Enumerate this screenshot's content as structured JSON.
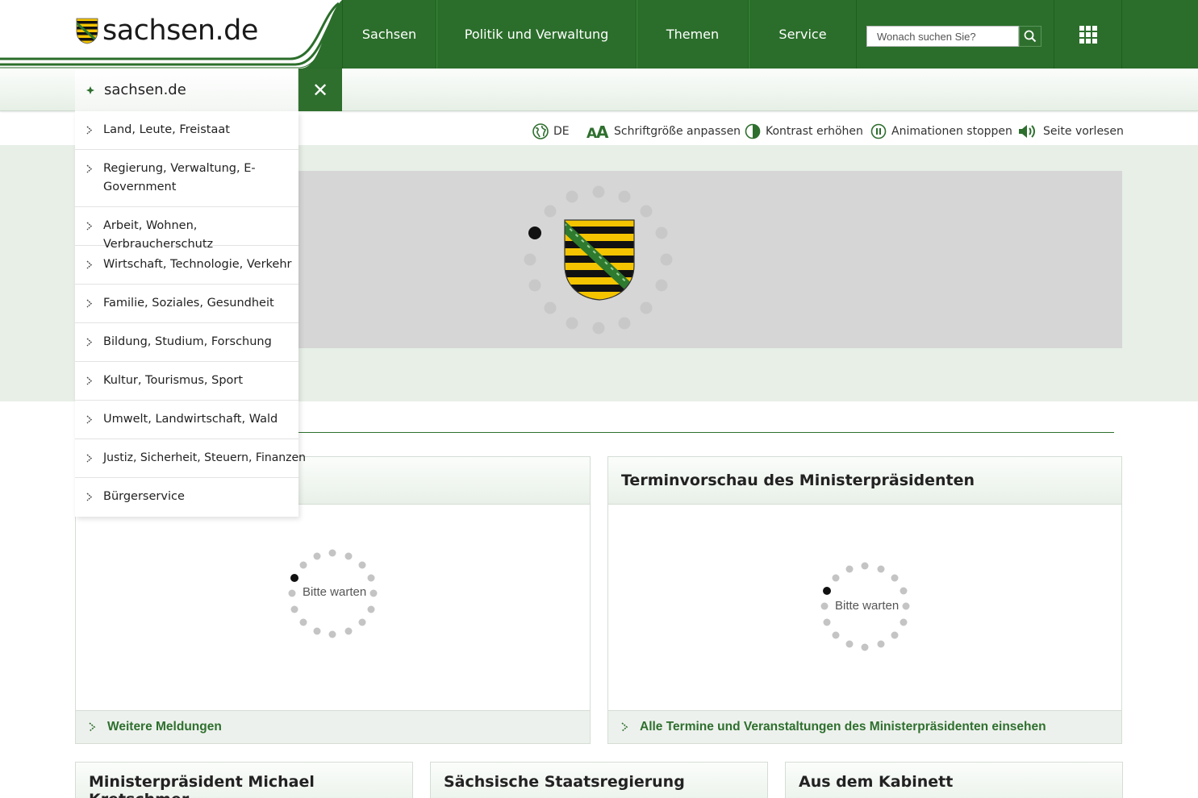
{
  "brand": {
    "site_name": "sachsen.de"
  },
  "nav": {
    "items": [
      {
        "label": "Sachsen"
      },
      {
        "label": "Politik und Verwaltung"
      },
      {
        "label": "Themen"
      },
      {
        "label": "Service"
      }
    ],
    "search_placeholder": "Wonach suchen Sie?"
  },
  "menu": {
    "title": "sachsen.de",
    "close_symbol": "✕",
    "items": [
      {
        "label": "Land, Leute, Freistaat"
      },
      {
        "label": "Regierung, Verwaltung, E-Government"
      },
      {
        "label": "Arbeit, Wohnen, Verbraucherschutz"
      },
      {
        "label": "Wirtschaft, Technologie, Verkehr"
      },
      {
        "label": "Familie, Soziales, Gesundheit"
      },
      {
        "label": "Bildung, Studium, Forschung"
      },
      {
        "label": "Kultur, Tourismus, Sport"
      },
      {
        "label": "Umwelt, Landwirtschaft, Wald"
      },
      {
        "label": "Justiz, Sicherheit, Steuern, Finanzen"
      },
      {
        "label": "Bürgerservice"
      }
    ]
  },
  "a11y": {
    "language": "DE",
    "font_size": "Schriftgröße anpassen",
    "contrast": "Kontrast erhöhen",
    "animations": "Animationen stoppen",
    "read_aloud": "Seite vorlesen"
  },
  "panels": {
    "news": {
      "loading": "Bitte warten",
      "footer_link": "Weitere Meldungen"
    },
    "appointments": {
      "title": "Terminvorschau des Ministerpräsidenten",
      "loading": "Bitte warten",
      "footer_link": "Alle Termine und Veranstaltungen des Ministerpräsidenten einsehen"
    }
  },
  "bottom": [
    {
      "title": "Ministerpräsident Michael Kretschmer"
    },
    {
      "title": "Sächsische Staatsregierung"
    },
    {
      "title": "Aus dem Kabinett"
    }
  ],
  "colors": {
    "brand_green": "#2e6f2e",
    "background_band": "#e7efe7",
    "hero_placeholder": "#d6d6d6"
  },
  "icons": [
    "saxony-coat-of-arms-icon",
    "search-icon",
    "apps-grid-icon",
    "close-icon",
    "globe-icon",
    "font-size-icon",
    "contrast-icon",
    "pause-icon",
    "speaker-icon",
    "chevron-right-icon",
    "loading-spinner-icon"
  ]
}
